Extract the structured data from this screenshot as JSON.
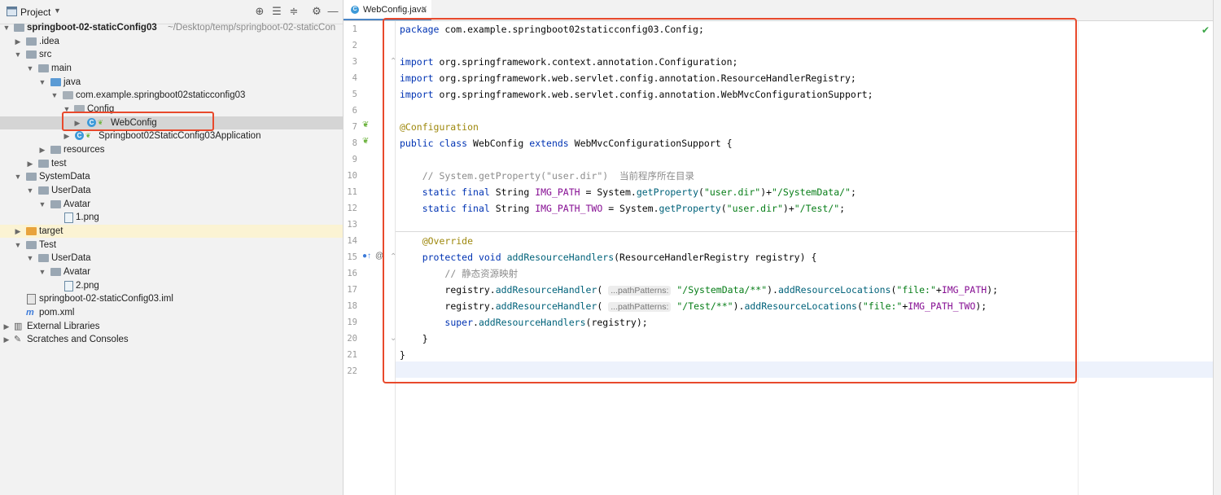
{
  "project_panel": {
    "title": "Project",
    "dropdown_icon": "caret-down-icon",
    "toolbar_icons": [
      "locate-icon",
      "expand-all-icon",
      "collapse-all-icon",
      "gear-icon",
      "minimize-icon"
    ]
  },
  "tree": [
    {
      "label": "springboot-02-staticConfig03",
      "extra": "~/Desktop/temp/springboot-02-staticCon",
      "icon": "module-folder",
      "arrow": "down"
    },
    {
      "label": ".idea",
      "icon": "folder",
      "arrow": "right"
    },
    {
      "label": "src",
      "icon": "folder",
      "arrow": "down"
    },
    {
      "label": "main",
      "icon": "folder",
      "arrow": "down"
    },
    {
      "label": "java",
      "icon": "source-folder",
      "arrow": "down"
    },
    {
      "label": "com.example.springboot02staticconfig03",
      "icon": "package",
      "arrow": "down"
    },
    {
      "label": "Config",
      "icon": "package",
      "arrow": "down"
    },
    {
      "label": "WebConfig",
      "icon": "class",
      "arrow": "right"
    },
    {
      "label": "Springboot02StaticConfig03Application",
      "icon": "class",
      "arrow": "right"
    },
    {
      "label": "resources",
      "icon": "resources-folder",
      "arrow": "right"
    },
    {
      "label": "test",
      "icon": "folder",
      "arrow": "right"
    },
    {
      "label": "SystemData",
      "icon": "folder",
      "arrow": "down"
    },
    {
      "label": "UserData",
      "icon": "folder",
      "arrow": "down"
    },
    {
      "label": "Avatar",
      "icon": "folder",
      "arrow": "down"
    },
    {
      "label": "1.png",
      "icon": "image-file"
    },
    {
      "label": "target",
      "icon": "excluded-folder",
      "arrow": "right"
    },
    {
      "label": "Test",
      "icon": "folder",
      "arrow": "down"
    },
    {
      "label": "UserData",
      "icon": "folder",
      "arrow": "down"
    },
    {
      "label": "Avatar",
      "icon": "folder",
      "arrow": "down"
    },
    {
      "label": "2.png",
      "icon": "image-file"
    },
    {
      "label": "springboot-02-staticConfig03.iml",
      "icon": "iml-file"
    },
    {
      "label": "pom.xml",
      "icon": "maven-file"
    },
    {
      "label": "External Libraries",
      "icon": "library",
      "arrow": "right"
    },
    {
      "label": "Scratches and Consoles",
      "icon": "scratches",
      "arrow": "right"
    }
  ],
  "editor": {
    "tab_label": "WebConfig.java",
    "tab_icon": "class-icon",
    "lines": [
      {
        "n": "1"
      },
      {
        "n": "2"
      },
      {
        "n": "3"
      },
      {
        "n": "4"
      },
      {
        "n": "5"
      },
      {
        "n": "6"
      },
      {
        "n": "7"
      },
      {
        "n": "8"
      },
      {
        "n": "9"
      },
      {
        "n": "10"
      },
      {
        "n": "11"
      },
      {
        "n": "12"
      },
      {
        "n": "13"
      },
      {
        "n": "14"
      },
      {
        "n": "15"
      },
      {
        "n": "16"
      },
      {
        "n": "17"
      },
      {
        "n": "18"
      },
      {
        "n": "19"
      },
      {
        "n": "20"
      },
      {
        "n": "21"
      },
      {
        "n": "22"
      }
    ],
    "code": {
      "l1_kw": "package",
      "l1_rest": " com.example.springboot02staticconfig03.Config;",
      "l3_kw": "import",
      "l3_rest": " org.springframework.context.annotation.Configuration;",
      "l4_kw": "import",
      "l4_rest": " org.springframework.web.servlet.config.annotation.ResourceHandlerRegistry;",
      "l5_kw": "import",
      "l5_rest": " org.springframework.web.servlet.config.annotation.WebMvcConfigurationSupport;",
      "l7_ann": "@Configuration",
      "l8_kw": "public class",
      "l8_name": " WebConfig ",
      "l8_kw2": "extends",
      "l8_rest": " WebMvcConfigurationSupport {",
      "l10_comment": "// System.getProperty(\"user.dir\")  当前程序所在目录",
      "l11_kw": "static final",
      "l11_type": " String ",
      "l11_field": "IMG_PATH",
      "l11_mid": " = System.",
      "l11_mth": "getProperty",
      "l11_p1": "(",
      "l11_s1": "\"user.dir\"",
      "l11_p2": ")+",
      "l11_s2": "\"/SystemData/\"",
      "l11_end": ";",
      "l12_kw": "static final",
      "l12_type": " String ",
      "l12_field": "IMG_PATH_TWO",
      "l12_mid": " = System.",
      "l12_mth": "getProperty",
      "l12_p1": "(",
      "l12_s1": "\"user.dir\"",
      "l12_p2": ")+",
      "l12_s2": "\"/Test/\"",
      "l12_end": ";",
      "l14_ann": "@Override",
      "l15_kw": "protected void",
      "l15_mth": " addResourceHandlers",
      "l15_rest": "(ResourceHandlerRegistry registry) {",
      "l16_comment": "// 静态资源映射",
      "l17_a": "registry.",
      "l17_mth": "addResourceHandler",
      "l17_p": "( ",
      "l17_hint": "...pathPatterns:",
      "l17_s1": "\"/SystemData/**\"",
      "l17_b": ").",
      "l17_mth2": "addResourceLocations",
      "l17_c": "(",
      "l17_s2": "\"file:\"",
      "l17_d": "+",
      "l17_field": "IMG_PATH",
      "l17_e": ");",
      "l18_a": "registry.",
      "l18_mth": "addResourceHandler",
      "l18_p": "( ",
      "l18_hint": "...pathPatterns:",
      "l18_s1": "\"/Test/**\"",
      "l18_b": ").",
      "l18_mth2": "addResourceLocations",
      "l18_c": "(",
      "l18_s2": "\"file:\"",
      "l18_d": "+",
      "l18_field": "IMG_PATH_TWO",
      "l18_e": ");",
      "l19_kw": "super",
      "l19_rest": ".",
      "l19_mth": "addResourceHandlers",
      "l19_end": "(registry);",
      "l20": "}",
      "l21": "}"
    },
    "status_icon": "check-mark-icon"
  },
  "colors": {
    "highlight_box": "#e8492c",
    "keyword": "#0033b3",
    "string": "#067d17",
    "annotation": "#9e880d",
    "field": "#871094",
    "comment": "#8c8c8c"
  }
}
